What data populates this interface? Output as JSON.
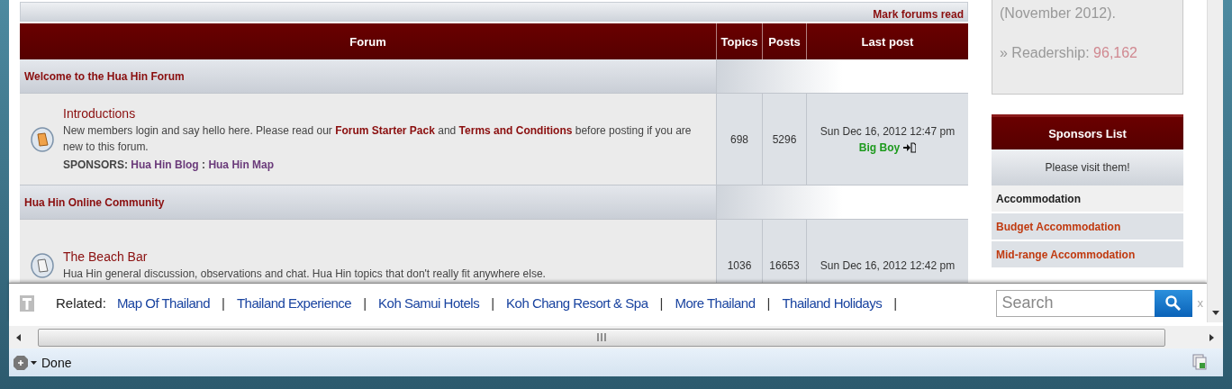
{
  "forum_table": {
    "mark_read_link": "Mark forums read",
    "columns": [
      "Forum",
      "Topics",
      "Posts",
      "Last post"
    ],
    "categories": [
      {
        "title": "Welcome to the Hua Hin Forum",
        "forums": [
          {
            "name": "Introductions",
            "unread": true,
            "description": [
              {
                "kind": "text",
                "text": "New members login and say hello here. Please read our"
              },
              {
                "kind": "link",
                "text": "Forum Starter Pack"
              },
              {
                "kind": "text",
                "text": "and"
              },
              {
                "kind": "link",
                "text": "Terms and Conditions"
              },
              {
                "kind": "text",
                "text": "before posting if you are new to this forum."
              }
            ],
            "sponsors": [
              {
                "kind": "label",
                "text": "SPONSORS:"
              },
              {
                "kind": "sponsor_link",
                "text": "Hua Hin Blog"
              },
              {
                "kind": "text",
                "text": ":"
              },
              {
                "kind": "sponsor_link",
                "text": "Hua Hin Map"
              }
            ],
            "topics": "698",
            "posts": "5296",
            "last_post": {
              "date": "Sun Dec 16, 2012 12:47 pm",
              "user": "Big Boy"
            }
          }
        ]
      },
      {
        "title": "Hua Hin Online Community",
        "forums": [
          {
            "name": "The Beach Bar",
            "unread": false,
            "description": [
              {
                "kind": "text",
                "text": "Hua Hin general discussion, observations and chat. Hua Hin topics that don't really fit anywhere else."
              }
            ],
            "topics": "1036",
            "posts": "16653",
            "last_post": {
              "date": "Sun Dec 16, 2012 12:42 pm"
            }
          }
        ]
      }
    ]
  },
  "sidebar": {
    "info": {
      "note": "(November 2012).",
      "readership_label": "» Readership:",
      "readership_value": "96,162"
    },
    "sponsors": {
      "title": "Sponsors List",
      "subtitle": "Please visit them!",
      "items": [
        {
          "kind": "heading",
          "text": "Accommodation"
        },
        {
          "kind": "link",
          "text": "Budget Accommodation"
        },
        {
          "kind": "link",
          "text": "Mid-range Accommodation"
        }
      ]
    }
  },
  "related_bar": {
    "label": "Related:",
    "links": [
      "Map Of Thailand",
      "Thailand Experience",
      "Koh Samui Hotels",
      "Koh Chang Resort & Spa",
      "More Thailand",
      "Thailand Holidays"
    ],
    "separator": "|",
    "search": {
      "placeholder": "Search"
    },
    "close": "x"
  },
  "status_bar": {
    "text": "Done"
  }
}
